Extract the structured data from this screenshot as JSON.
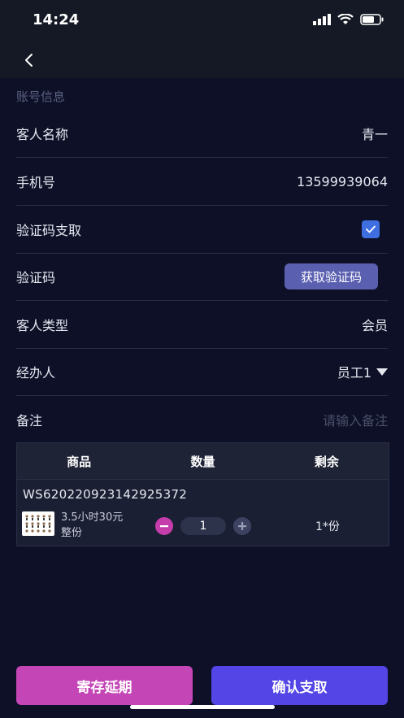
{
  "status": {
    "time": "14:24"
  },
  "section": {
    "title": "账号信息"
  },
  "fields": {
    "guest_name": {
      "label": "客人名称",
      "value": "青一"
    },
    "phone": {
      "label": "手机号",
      "value": "13599939064"
    },
    "verify_pickup": {
      "label": "验证码支取",
      "checked": true
    },
    "verify_code": {
      "label": "验证码",
      "button": "获取验证码"
    },
    "guest_type": {
      "label": "客人类型",
      "value": "会员"
    },
    "handler": {
      "label": "经办人",
      "value": "员工1"
    },
    "remark": {
      "label": "备注",
      "placeholder": "请输入备注"
    }
  },
  "table": {
    "headers": [
      "商品",
      "数量",
      "剩余"
    ],
    "order_no": "WS620220923142925372",
    "item": {
      "name_line1": "3.5小时30元",
      "name_line2": "整份",
      "quantity": "1",
      "remaining": "1*份"
    }
  },
  "actions": {
    "store_extend": "寄存延期",
    "confirm_pickup": "确认支取"
  },
  "colors": {
    "background": "#0d1027",
    "store_button": "#c446b6",
    "confirm_button": "#5345e6",
    "checkbox": "#3f6ee0"
  }
}
